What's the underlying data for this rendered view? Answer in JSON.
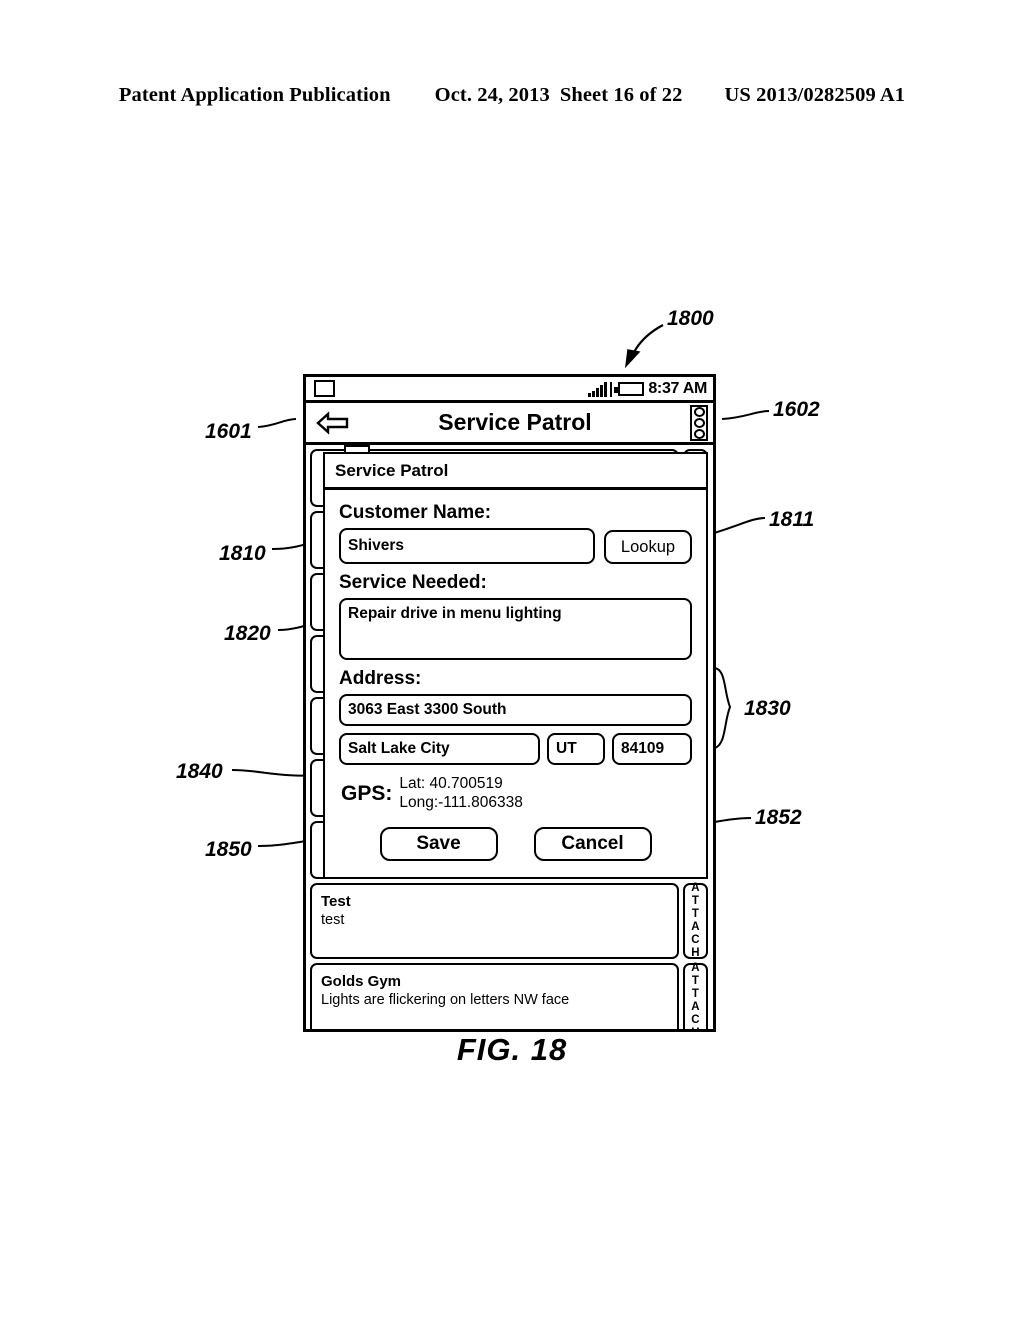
{
  "publication_header": {
    "left": "Patent Application Publication",
    "date": "Oct. 24, 2013",
    "sheet": "Sheet 16 of 22",
    "number": "US 2013/0282509 A1"
  },
  "figure": {
    "caption": "FIG. 18"
  },
  "reference_numerals": {
    "device": "1800",
    "back_button": "1601",
    "overflow_menu": "1602",
    "customer_name_field": "1810",
    "lookup_button": "1811",
    "service_needed_field": "1820",
    "address_group": "1830",
    "gps_group": "1840",
    "save_button": "1850",
    "cancel_button": "1852"
  },
  "status_bar": {
    "notification_icon": "square-notification-icon",
    "signal_icon": "signal-bars-icon",
    "battery_icon": "battery-icon",
    "time": "8:37 AM"
  },
  "action_bar": {
    "back_icon": "back-arrow-icon",
    "title": "Service Patrol",
    "overflow_icon": "overflow-menu-icon"
  },
  "dialog": {
    "title": "Service Patrol",
    "customer_name": {
      "label": "Customer Name:",
      "value": "Shivers",
      "lookup_label": "Lookup"
    },
    "service_needed": {
      "label": "Service Needed:",
      "value": "Repair drive in menu lighting"
    },
    "address": {
      "label": "Address:",
      "street": "3063 East 3300 South",
      "city": "Salt Lake City",
      "state": "UT",
      "zip": "84109"
    },
    "gps": {
      "label": "GPS:",
      "lat": "Lat: 40.700519",
      "long": "Long:-111.806338"
    },
    "actions": {
      "save": "Save",
      "cancel": "Cancel"
    }
  },
  "background_list": {
    "attach_label": "ATTACH",
    "items": [
      {
        "title": "Test",
        "subtitle": "test"
      },
      {
        "title": "Golds Gym",
        "subtitle": "Lights are flickering on letters NW face"
      }
    ]
  }
}
